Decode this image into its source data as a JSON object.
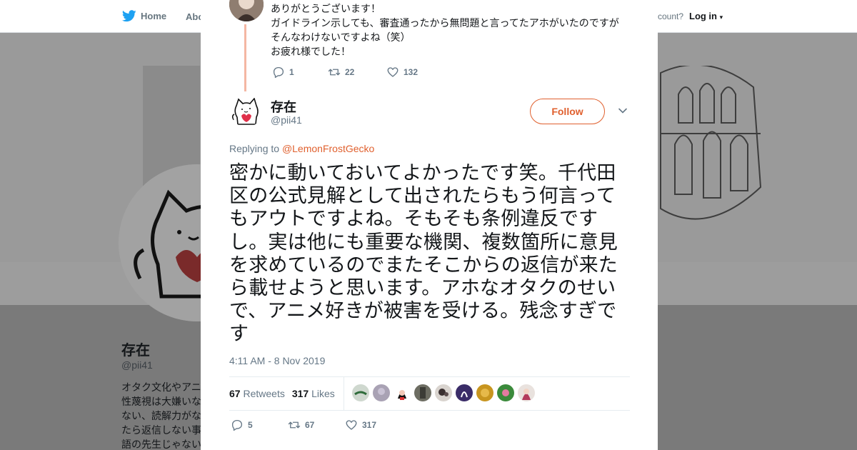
{
  "background": {
    "nav_home": "Home",
    "nav_about": "Abo",
    "account_text": "ccount?",
    "login_label": "Log in",
    "profile_name": "存在",
    "profile_handle": "@pii41",
    "bio_lines": [
      "オタク文化やアニ",
      "性蔑視は大嫌いな",
      "ない、読解力がな",
      "たら返信しない事",
      "語の先生じゃない"
    ]
  },
  "prev_tweet": {
    "lines": [
      "ありがとうございます！",
      "ガイドライン示しても、審査通ったから無問題と言ってたアホがいたのですが",
      "そんなわけないですよね（笑）",
      "お疲れ様でした！"
    ],
    "replies": "1",
    "retweets": "22",
    "likes": "132"
  },
  "tweet": {
    "author_name": "存在",
    "author_handle": "@pii41",
    "follow_label": "Follow",
    "replying_prefix": "Replying to ",
    "replying_to": "@LemonFrostGecko",
    "text": "密かに動いておいてよかったです笑。千代田区の公式見解として出されたらもう何言ってもアウトですよね。そもそも条例違反ですし。実は他にも重要な機関、複数箇所に意見を求めているのでまたそこからの返信が来たら載せようと思います。アホなオタクのせいで、アニメ好きが被害を受ける。残念すぎです",
    "timestamp": "4:11 AM - 8 Nov 2019",
    "retweet_count": "67",
    "retweet_label": "Retweets",
    "like_count": "317",
    "like_label": "Likes",
    "replies": "5",
    "retweets": "67",
    "likes": "317"
  },
  "icons": [
    "twitter-bird-icon",
    "close-icon",
    "reply-icon",
    "retweet-icon",
    "heart-icon",
    "chevron-down-icon"
  ],
  "colors": {
    "accent": "#e0602e",
    "thread_line": "#f4b7a3",
    "muted": "#657786"
  }
}
